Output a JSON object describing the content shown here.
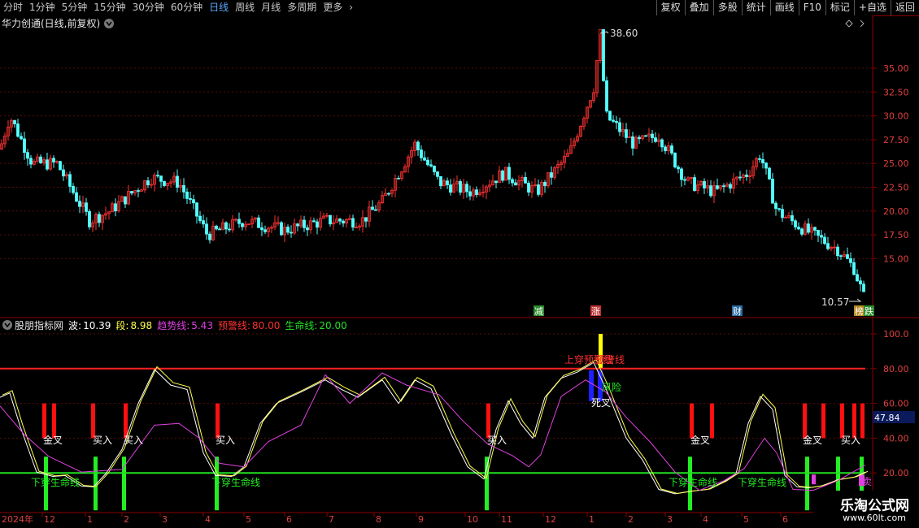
{
  "toolbar": {
    "timeframes": [
      "分时",
      "1分钟",
      "5分钟",
      "15分钟",
      "30分钟",
      "60分钟",
      "日线",
      "周线",
      "月线",
      "多周期"
    ],
    "active_timeframe": "日线",
    "more": "更多",
    "right_buttons": [
      "复权",
      "叠加",
      "多股",
      "统计",
      "画线",
      "F10",
      "标记",
      "+自选",
      "返回"
    ]
  },
  "main_chart": {
    "title": "华力创通(日线,前复权)",
    "high_label": "38.60",
    "low_label": "10.57",
    "y_ticks": [
      "35.00",
      "32.50",
      "30.00",
      "27.50",
      "25.00",
      "22.50",
      "20.00",
      "17.50",
      "15.00"
    ],
    "tags": [
      "减",
      "涨",
      "财",
      "榜",
      "跌"
    ],
    "colors": {
      "up": "#ff3232",
      "down": "#54ffff",
      "grid": "#7a1414"
    }
  },
  "indicator": {
    "name": "股朋指标网",
    "legend": [
      {
        "label": "波:",
        "value": "10.39",
        "color": "#ffffff"
      },
      {
        "label": "段:",
        "value": "8.98",
        "color": "#ffff4a"
      },
      {
        "label": "趋势线:",
        "value": "5.43",
        "color": "#e040e0"
      },
      {
        "label": "预警线:",
        "value": "80.00",
        "color": "#ff3030"
      },
      {
        "label": "生命线:",
        "value": "20.00",
        "color": "#22e022"
      }
    ],
    "y_ticks": [
      "100.0",
      "80.00",
      "60.00",
      "40.00",
      "20.00"
    ],
    "current_value": "47.84",
    "signals": {
      "golden_cross": "金叉",
      "buy": "买入",
      "cross_down": "下穿生命线",
      "cross_up": "上穿预警线",
      "warning": "预警线",
      "risk": "风险",
      "dead_cross": "死叉",
      "sell": "卖"
    }
  },
  "x_axis": {
    "year_label": "2024年",
    "month_ticks": [
      "12",
      "1",
      "2",
      "3",
      "4",
      "5",
      "6",
      "7",
      "8",
      "9",
      "10",
      "11",
      "12",
      "1",
      "2",
      "3",
      "4",
      "5",
      "6"
    ]
  },
  "watermark": {
    "title": "乐淘公式网",
    "url": "www.60lt.com"
  }
}
